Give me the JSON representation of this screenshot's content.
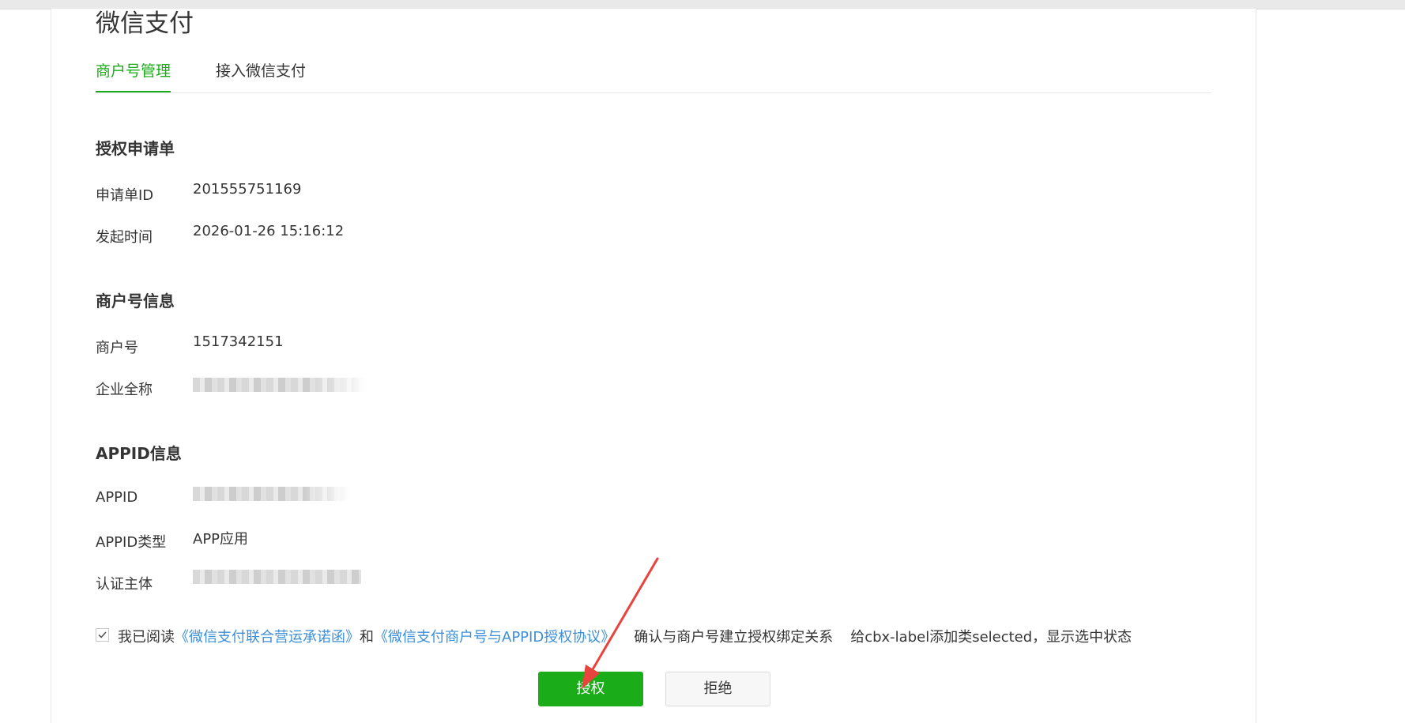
{
  "header": {
    "title": "微信支付"
  },
  "tabs": [
    {
      "label": "商户号管理",
      "active": true
    },
    {
      "label": "接入微信支付",
      "active": false
    }
  ],
  "sections": {
    "application": {
      "title": "授权申请单",
      "fields": [
        {
          "label": "申请单ID",
          "value": "201555751169"
        },
        {
          "label": "发起时间",
          "value": "2026-01-26 15:16:12"
        }
      ]
    },
    "merchant": {
      "title": "商户号信息",
      "fields": [
        {
          "label": "商户号",
          "value": "1517342151"
        },
        {
          "label": "企业全称",
          "value": ""
        }
      ]
    },
    "appid": {
      "title": "APPID信息",
      "fields": [
        {
          "label": "APPID",
          "value": ""
        },
        {
          "label": "APPID类型",
          "value": "APP应用"
        },
        {
          "label": "认证主体",
          "value": ""
        }
      ]
    }
  },
  "agreement": {
    "checked": true,
    "prefix": "我已阅读",
    "link1": "《微信支付联合营运承诺函》",
    "conjunction": "和",
    "link2": "《微信支付商户号与APPID授权协议》",
    "suffix": "确认与商户号建立授权绑定关系",
    "hint": "给cbx-label添加类selected，显示选中状态"
  },
  "actions": {
    "authorize_label": "授权",
    "reject_label": "拒绝"
  },
  "colors": {
    "accent": "#1aad19",
    "link": "#3d8fd6",
    "annotation_arrow": "#e8433d"
  },
  "annotation": {
    "icon": "red-arrow-icon"
  }
}
